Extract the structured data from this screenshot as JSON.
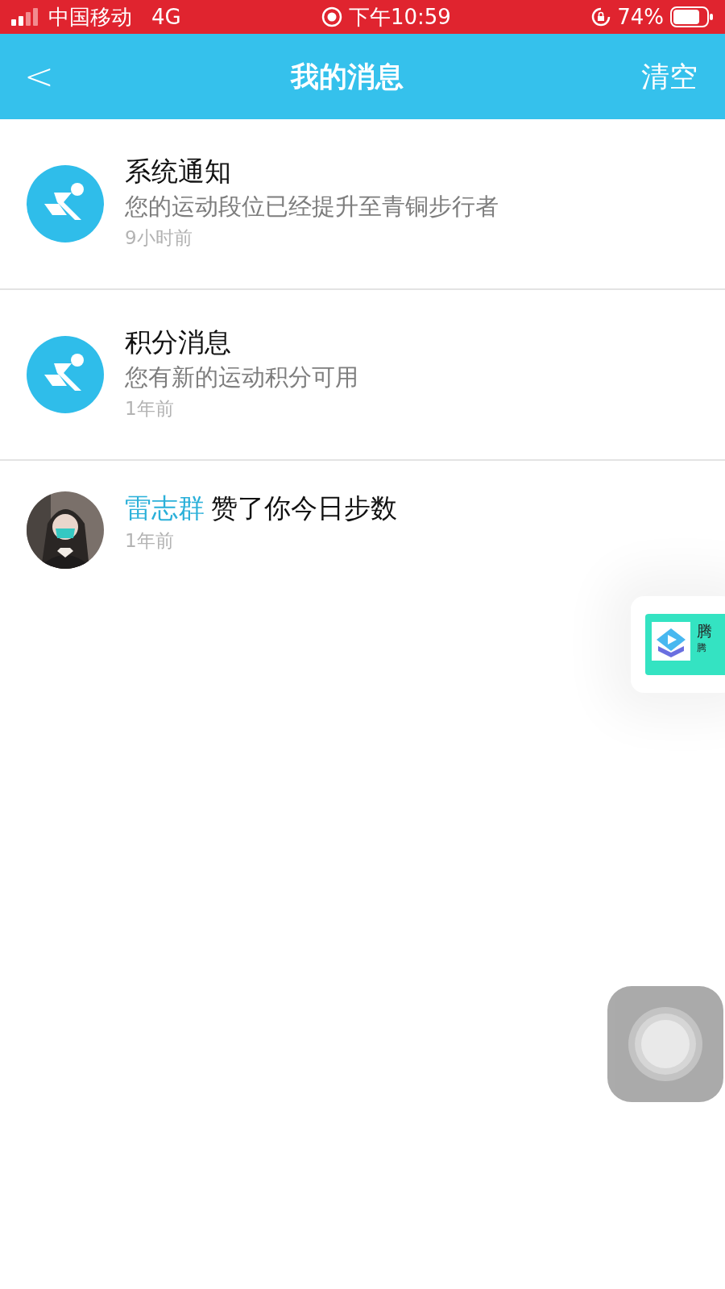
{
  "status_bar": {
    "carrier": "中国移动",
    "network": "4G",
    "time": "下午10:59",
    "battery": "74%"
  },
  "header": {
    "back": "<",
    "title": "我的消息",
    "action": "清空"
  },
  "messages": [
    {
      "kind": "system",
      "title": "系统通知",
      "body": "您的运动段位已经提升至青铜步行者",
      "time": "9小时前"
    },
    {
      "kind": "system",
      "title": "积分消息",
      "body": "您有新的运动积分可用",
      "time": "1年前"
    },
    {
      "kind": "like",
      "user": "雷志群",
      "body": "赞了你今日步数",
      "time": "1年前"
    }
  ],
  "floating_ad": {
    "title": "腾",
    "subtitle": "腾"
  }
}
